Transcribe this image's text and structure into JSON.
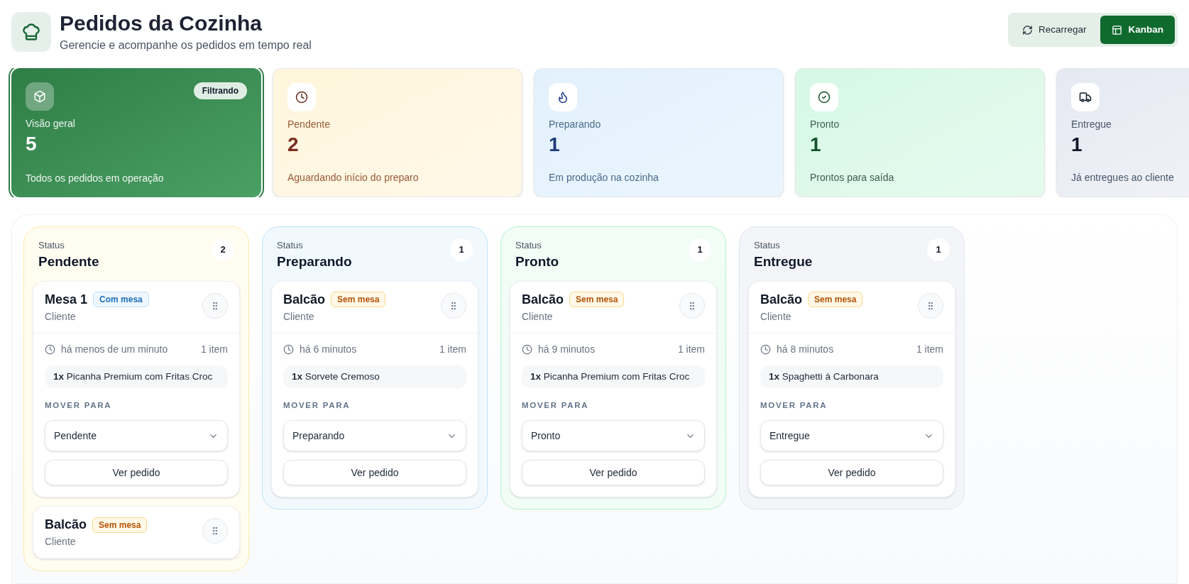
{
  "header": {
    "title": "Pedidos da Cozinha",
    "subtitle": "Gerencie e acompanhe os pedidos em tempo real"
  },
  "actions": [
    {
      "label": "Recarregar",
      "kind": "reload",
      "selected": false
    },
    {
      "label": "Kanban",
      "kind": "kanban",
      "selected": true
    }
  ],
  "stats": [
    {
      "kind": "all",
      "label": "Visão geral",
      "value": "5",
      "caption": "Todos os pedidos em operação",
      "selected": true,
      "badge": "Filtrando"
    },
    {
      "kind": "pending",
      "label": "Pendente",
      "value": "2",
      "caption": "Aguardando início do preparo",
      "selected": false
    },
    {
      "kind": "preparing",
      "label": "Preparando",
      "value": "1",
      "caption": "Em produção na cozinha",
      "selected": false
    },
    {
      "kind": "ready",
      "label": "Pronto",
      "value": "1",
      "caption": "Prontos para saída",
      "selected": false
    },
    {
      "kind": "delivered",
      "label": "Entregue",
      "value": "1",
      "caption": "Já entregues ao cliente",
      "selected": false
    }
  ],
  "columns": [
    {
      "kind": "pending",
      "caption": "Status",
      "title": "Pendente",
      "count": "2",
      "orders": [
        {
          "title": "Mesa 1",
          "tag": {
            "label": "Com mesa",
            "kind": "table"
          },
          "customer": "Cliente",
          "time": "há menos de um minuto",
          "item_count": "1 item",
          "items": [
            {
              "qty": "1x",
              "name": "Picanha Premium com Fritas Croc"
            }
          ],
          "move_label": "MOVER PARA",
          "status": "Pendente",
          "action": "Ver pedido"
        },
        {
          "title": "Balcão",
          "tag": {
            "label": "Sem mesa",
            "kind": "counter"
          },
          "customer": "Cliente"
        }
      ]
    },
    {
      "kind": "preparing",
      "caption": "Status",
      "title": "Preparando",
      "count": "1",
      "orders": [
        {
          "title": "Balcão",
          "tag": {
            "label": "Sem mesa",
            "kind": "counter"
          },
          "customer": "Cliente",
          "time": "há 6 minutos",
          "item_count": "1 item",
          "items": [
            {
              "qty": "1x",
              "name": "Sorvete Cremoso"
            }
          ],
          "move_label": "MOVER PARA",
          "status": "Preparando",
          "action": "Ver pedido"
        }
      ]
    },
    {
      "kind": "ready",
      "caption": "Status",
      "title": "Pronto",
      "count": "1",
      "orders": [
        {
          "title": "Balcão",
          "tag": {
            "label": "Sem mesa",
            "kind": "counter"
          },
          "customer": "Cliente",
          "time": "há 9 minutos",
          "item_count": "1 item",
          "items": [
            {
              "qty": "1x",
              "name": "Picanha Premium com Fritas Croc"
            }
          ],
          "move_label": "MOVER PARA",
          "status": "Pronto",
          "action": "Ver pedido"
        }
      ]
    },
    {
      "kind": "delivered",
      "caption": "Status",
      "title": "Entregue",
      "count": "1",
      "orders": [
        {
          "title": "Balcão",
          "tag": {
            "label": "Sem mesa",
            "kind": "counter"
          },
          "customer": "Cliente",
          "time": "há 8 minutos",
          "item_count": "1 item",
          "items": [
            {
              "qty": "1x",
              "name": "Spaghetti à Carbonara"
            }
          ],
          "move_label": "MOVER PARA",
          "status": "Entregue",
          "action": "Ver pedido"
        }
      ]
    }
  ]
}
